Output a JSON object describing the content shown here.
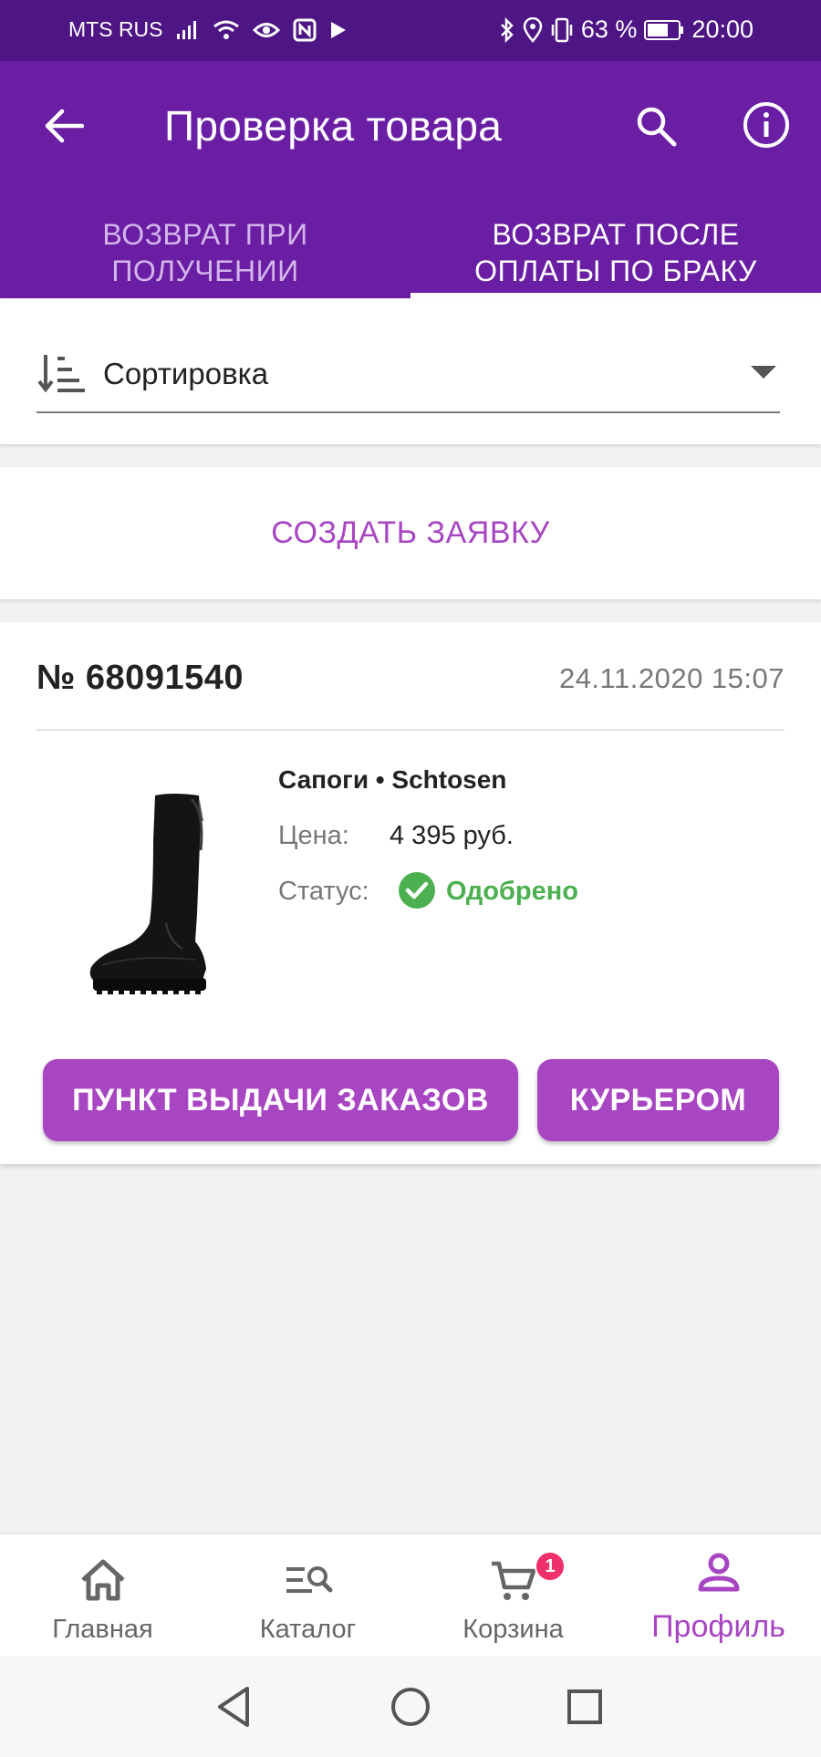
{
  "status_bar": {
    "carrier": "MTS RUS",
    "battery": "63 %",
    "time": "20:00"
  },
  "header": {
    "title": "Проверка товара",
    "icons": [
      "back-arrow-icon",
      "search-icon",
      "info-icon"
    ]
  },
  "tabs": [
    {
      "label_line1": "ВОЗВРАТ ПРИ",
      "label_line2": "ПОЛУЧЕНИИ",
      "active": false
    },
    {
      "label_line1": "ВОЗВРАТ ПОСЛЕ",
      "label_line2": "ОПЛАТЫ ПО БРАКУ",
      "active": true
    }
  ],
  "sort": {
    "label": "Сортировка"
  },
  "create_request": {
    "label": "СОЗДАТЬ ЗАЯВКУ"
  },
  "order": {
    "number": "№ 68091540",
    "date": "24.11.2020 15:07",
    "product_name": "Сапоги • Schtosen",
    "price_label": "Цена:",
    "price_value": "4 395 руб.",
    "status_label": "Статус:",
    "status_value": "Одобрено",
    "buttons": {
      "pickup": "ПУНКТ ВЫДАЧИ ЗАКАЗОВ",
      "courier": "КУРЬЕРОМ"
    }
  },
  "bottom_nav": [
    {
      "label": "Главная",
      "icon": "home-icon"
    },
    {
      "label": "Каталог",
      "icon": "catalog-search-icon"
    },
    {
      "label": "Корзина",
      "icon": "cart-icon",
      "badge": "1"
    },
    {
      "label": "Профиль",
      "icon": "profile-icon",
      "active": true
    }
  ],
  "colors": {
    "status_bar": "#4e1585",
    "app_bar": "#6a1ea4",
    "accent": "#a845c2",
    "success": "#4caf50",
    "badge": "#f0306a"
  }
}
